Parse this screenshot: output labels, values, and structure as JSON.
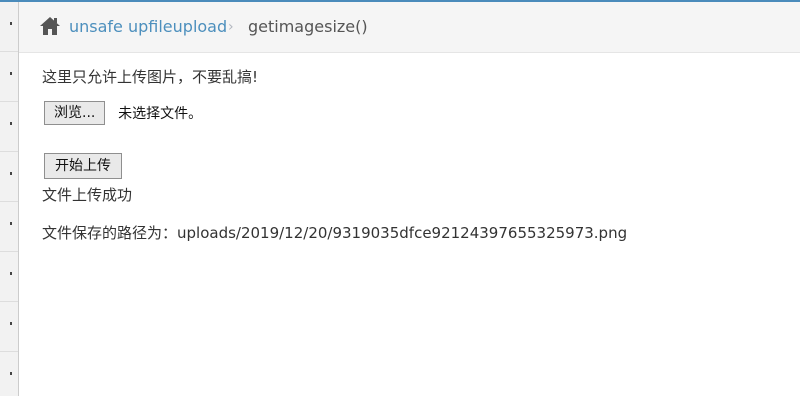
{
  "breadcrumb": {
    "home_icon": "home-icon",
    "parent_label": "unsafe upfileupload",
    "separator": "›",
    "current_label": "getimagesize()"
  },
  "colors": {
    "accent": "#4a8bbb",
    "link": "#4c8fbd"
  },
  "upload": {
    "notice": "这里只允许上传图片，不要乱搞!",
    "browse_label": "浏览...",
    "file_status": "未选择文件。",
    "submit_label": "开始上传",
    "success_message": "文件上传成功",
    "path_message": "文件保存的路径为：uploads/2019/12/20/9319035dfce92124397655325973.png"
  }
}
